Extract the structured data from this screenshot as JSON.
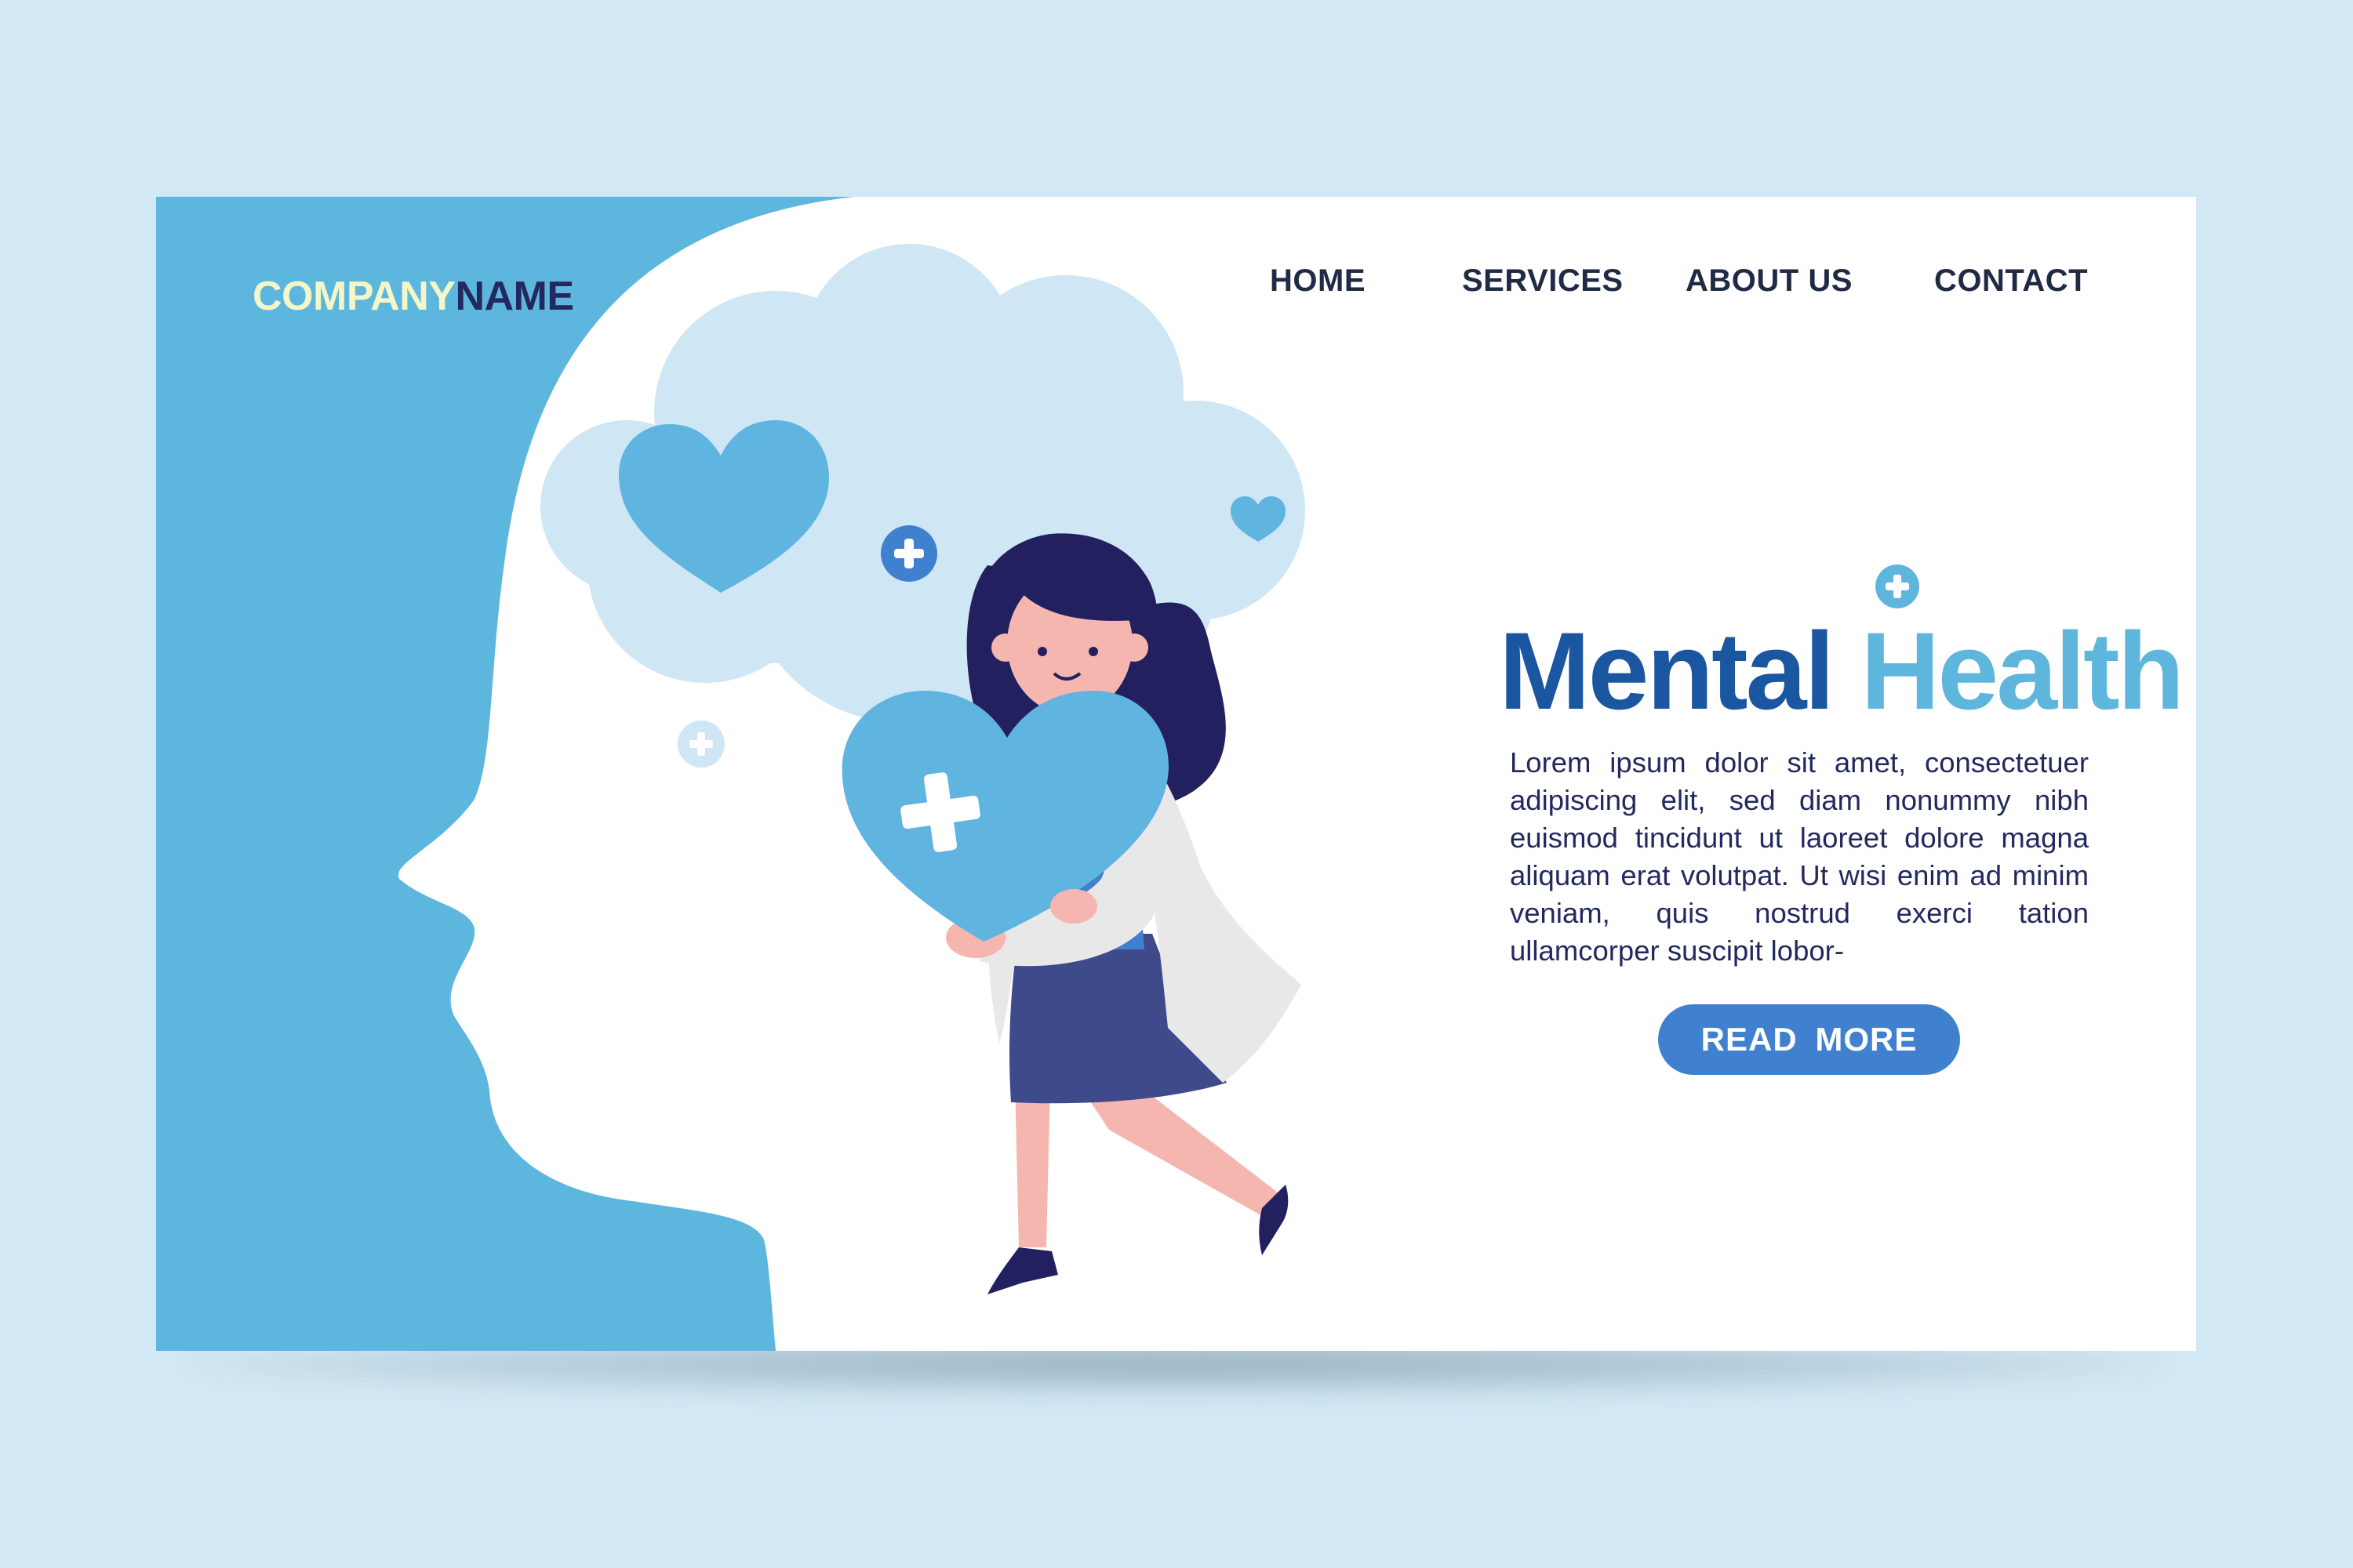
{
  "logo": {
    "part1": "COMPANY",
    "part2": "NAME"
  },
  "nav": {
    "home": "HOME",
    "services": "SERVICES",
    "about": "ABOUT US",
    "contact": "CONTACT"
  },
  "hero": {
    "title_part1": "Mental",
    "title_part2": "Health",
    "body": "Lorem ipsum dolor sit amet, consectetuer adipiscing elit, sed diam nonummy nibh euismod tincidunt ut laoreet dolore magna aliquam erat volutpat. Ut wisi enim ad minim veniam, quis nostrud exerci tation ullamcorper suscipit lobor-",
    "cta": "READ MORE"
  },
  "illustration": {
    "icons": [
      "head-silhouette",
      "thought-cloud",
      "heart-icon",
      "plus-icon",
      "doctor-woman",
      "held-heart-icon"
    ]
  },
  "colors": {
    "background": "#d2e8f4",
    "page": "#ffffff",
    "blue_panel": "#5db6de",
    "cloud": "#cfe6f4",
    "heart": "#5fb5df",
    "dark_navy": "#23295f",
    "title_dark": "#1a57a0",
    "title_light": "#5fb6dd",
    "button": "#3f80cf"
  }
}
